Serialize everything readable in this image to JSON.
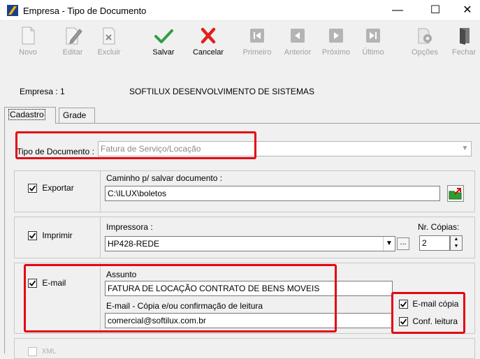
{
  "window": {
    "title": "Empresa - Tipo de Documento",
    "minimize": "—",
    "maximize": "☐",
    "close": "✕"
  },
  "toolbar": {
    "buttons": [
      {
        "label": "Novo",
        "icon": "new-document-icon",
        "enabled": false
      },
      {
        "label": "Editar",
        "icon": "edit-pencil-icon",
        "enabled": false
      },
      {
        "label": "Excluir",
        "icon": "delete-document-icon",
        "enabled": false
      },
      {
        "label": "Salvar",
        "icon": "checkmark-icon",
        "enabled": true
      },
      {
        "label": "Cancelar",
        "icon": "red-x-icon",
        "enabled": true
      },
      {
        "label": "Primeiro",
        "icon": "first-record-icon",
        "enabled": false
      },
      {
        "label": "Anterior",
        "icon": "previous-record-icon",
        "enabled": false
      },
      {
        "label": "Próximo",
        "icon": "next-record-icon",
        "enabled": false
      },
      {
        "label": "Último",
        "icon": "last-record-icon",
        "enabled": false
      },
      {
        "label": "Opções",
        "icon": "options-gear-icon",
        "enabled": false
      },
      {
        "label": "Fechar",
        "icon": "exit-door-icon",
        "enabled": false
      }
    ]
  },
  "company": {
    "label": "Empresa : 1",
    "name": "SOFTILUX DESENVOLVIMENTO DE SISTEMAS"
  },
  "tabs": [
    "Cadastro",
    "Grade"
  ],
  "form": {
    "tipo_label": "Tipo de Documento :",
    "tipo_value": "Fatura de Serviço/Locação",
    "exportar": {
      "label": "Exportar",
      "checked": true,
      "path_label": "Caminho p/ salvar documento :",
      "path_value": "C:\\ILUX\\boletos"
    },
    "imprimir": {
      "label": "Imprimir",
      "checked": true,
      "printer_label": "Impressora :",
      "printer_value": "HP428-REDE",
      "copies_label": "Nr. Cópias:",
      "copies_value": "2",
      "browse": "..."
    },
    "email": {
      "label": "E-mail",
      "checked": true,
      "subject_label": "Assunto",
      "subject_value": "FATURA DE LOCAÇÃO  CONTRATO DE BENS MOVEIS",
      "copy_label": "E-mail  -  Cópia e/ou confirmação de leitura",
      "copy_value": "comercial@softilux.com.br",
      "email_copia": "E-mail cópia",
      "conf_leitura": "Conf. leitura"
    },
    "xml_label": "XML"
  },
  "colors": {
    "highlight": "#e30613",
    "disabled_text": "#a0a0a0",
    "save_green": "#2ea043",
    "cancel_red": "#e0201b"
  }
}
